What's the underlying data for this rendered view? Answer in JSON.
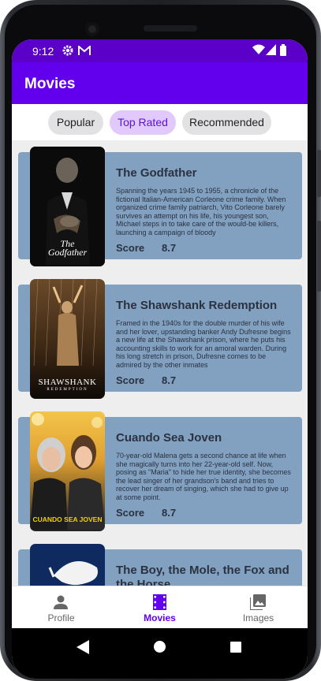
{
  "status_bar": {
    "time": "9:12"
  },
  "app_bar": {
    "title": "Movies"
  },
  "chips": [
    {
      "label": "Popular",
      "selected": false
    },
    {
      "label": "Top Rated",
      "selected": true
    },
    {
      "label": "Recommended",
      "selected": false
    }
  ],
  "movies": [
    {
      "title": "The Godfather",
      "description": "Spanning the years 1945 to 1955, a chronicle of the fictional Italian-American Corleone crime family. When organized crime family patriarch, Vito Corleone barely survives an attempt on his life, his youngest son, Michael steps in to take care of the would-be killers, launching a campaign of bloody",
      "score_label": "Score",
      "score": "8.7",
      "poster_text": "The Godfather"
    },
    {
      "title": "The Shawshank Redemption",
      "description": "Framed in the 1940s for the double murder of his wife and her lover, upstanding banker Andy Dufresne begins a new life at the Shawshank prison, where he puts his accounting skills to work for an amoral warden. During his long stretch in prison, Dufresne comes to be admired by the other inmates",
      "score_label": "Score",
      "score": "8.7",
      "poster_text": "SHAWSHANK",
      "poster_subtext": "REDEMPTION"
    },
    {
      "title": "Cuando Sea Joven",
      "description": "70-year-old Malena gets a second chance at life when she magically turns into her 22-year-old self. Now, posing as \"Maria\" to hide her true identity, she becomes the lead singer of her grandson's band and tries to recover her dream of singing, which she had to give up at some point.",
      "score_label": "Score",
      "score": "8.7",
      "poster_text": "CUANDO SEA JOVEN"
    },
    {
      "title": "The Boy, the Mole, the Fox and the Horse"
    }
  ],
  "bottom_nav": [
    {
      "label": "Profile",
      "icon": "person-icon",
      "active": false
    },
    {
      "label": "Movies",
      "icon": "film-icon",
      "active": true
    },
    {
      "label": "Images",
      "icon": "image-icon",
      "active": false
    }
  ],
  "colors": {
    "status_bar": "#5a00c8",
    "app_bar": "#6200ee",
    "card": "#82a0c0",
    "chip_selected_bg": "#e1c9fb",
    "chip_selected_text": "#5b13d6"
  }
}
